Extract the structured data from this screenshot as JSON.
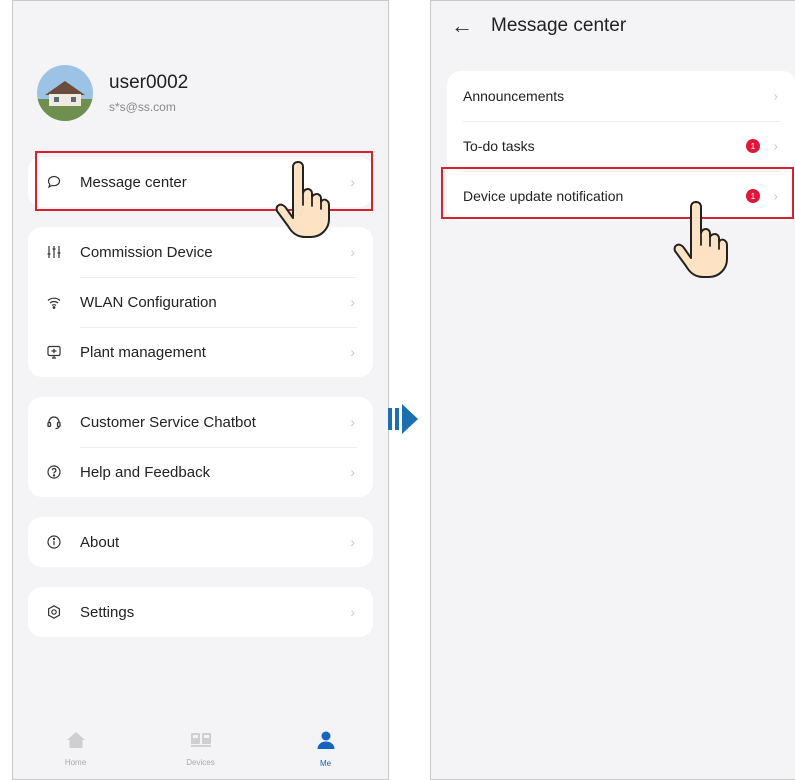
{
  "left": {
    "user": {
      "name": "user0002",
      "email": "s*s@ss.com"
    },
    "menu": {
      "message_center": "Message center",
      "group1": [
        "Commission Device",
        "WLAN Configuration",
        "Plant management"
      ],
      "group2": [
        "Customer Service Chatbot",
        "Help and Feedback"
      ],
      "about": "About",
      "settings": "Settings"
    },
    "tabs": [
      {
        "label": "Home",
        "icon": "home-icon"
      },
      {
        "label": "Devices",
        "icon": "devices-icon"
      },
      {
        "label": "Me",
        "icon": "person-icon",
        "active": true
      }
    ]
  },
  "right": {
    "header": {
      "title": "Message center"
    },
    "items": [
      {
        "label": "Announcements",
        "badge": ""
      },
      {
        "label": "To-do tasks",
        "badge": "1"
      },
      {
        "label": "Device update notification",
        "badge": "1"
      }
    ]
  },
  "colors": {
    "highlight": "#d6222f",
    "badge": "#e0173a",
    "accent": "#1565c0",
    "arrow": "#1a6fb0"
  }
}
